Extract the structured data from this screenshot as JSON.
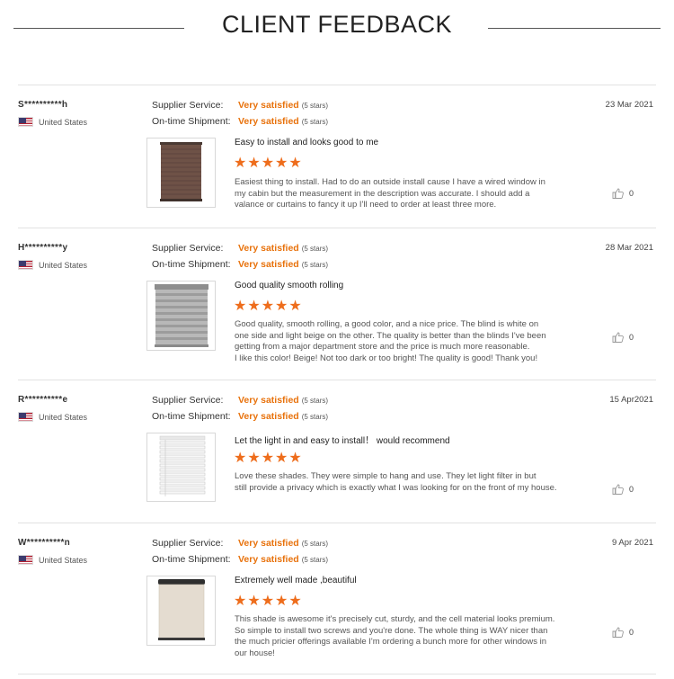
{
  "header": {
    "title": "CLIENT FEEDBACK"
  },
  "labels": {
    "supplier_service": "Supplier Service:",
    "on_time_shipment": "On-time Shipment:"
  },
  "reviews": [
    {
      "user": "S**********h",
      "country": "United States",
      "date": "23 Mar 2021",
      "supplier_service": "Very satisfied",
      "supplier_stars": "(5 stars)",
      "shipment": "Very satisfied",
      "shipment_stars": "(5 stars)",
      "title": "Easy to install and looks good to me",
      "stars": "★★★★★",
      "rating": 5,
      "body": [
        "Easiest thing to install. Had to do an outside install cause I have a wired window in",
        "my cabin but the measurement in the description was accurate. I should add a",
        "valance or curtains to fancy it up I'll need to order at least three more."
      ],
      "likes": "0",
      "image": "brown-cellular-shade"
    },
    {
      "user": "H**********y",
      "country": "United States",
      "date": "28 Mar 2021",
      "supplier_service": "Very satisfied",
      "supplier_stars": "(5 stars)",
      "shipment": "Very satisfied",
      "shipment_stars": "(5 stars)",
      "title": "Good quality   smooth rolling",
      "stars": "★★★★★",
      "rating": 5,
      "body": [
        "Good quality, smooth rolling, a good color, and a nice price. The blind is white on",
        "one side and light beige on the other. The quality is better than the blinds I've been",
        "getting from a major department store and the price is much more reasonable.",
        "I like this color! Beige! Not too dark or too bright! The quality is good! Thank you!"
      ],
      "likes": "0",
      "image": "grey-zebra-blind"
    },
    {
      "user": "R**********e",
      "country": "United States",
      "date": "15 Apr2021",
      "supplier_service": "Very satisfied",
      "supplier_stars": "(5 stars)",
      "shipment": "Very satisfied",
      "shipment_stars": "(5 stars)",
      "title": "Let the light in and easy  to install！ would recommend",
      "stars": "★★★★★",
      "rating": 5,
      "body": [
        "Love these shades. They were simple to hang and use. They let light filter in but",
        "still provide a privacy which is exactly what I was looking for on the front of my house."
      ],
      "likes": "0",
      "image": "white-venetian-blind"
    },
    {
      "user": "W**********n",
      "country": "United States",
      "date": "9 Apr 2021",
      "supplier_service": "Very satisfied",
      "supplier_stars": "(5 stars)",
      "shipment": "Very satisfied",
      "shipment_stars": "(5 stars)",
      "title": "Extremely well made ,beautiful",
      "stars": "★★★★★",
      "rating": 5,
      "body": [
        "This shade is awesome it's precisely cut, sturdy, and the cell material looks premium.",
        "So simple to install two screws and you're done. The whole thing is WAY nicer than",
        "the much pricier offerings available I'm ordering a bunch more for other windows in",
        "our house!"
      ],
      "likes": "0",
      "image": "beige-roller-shade"
    }
  ]
}
